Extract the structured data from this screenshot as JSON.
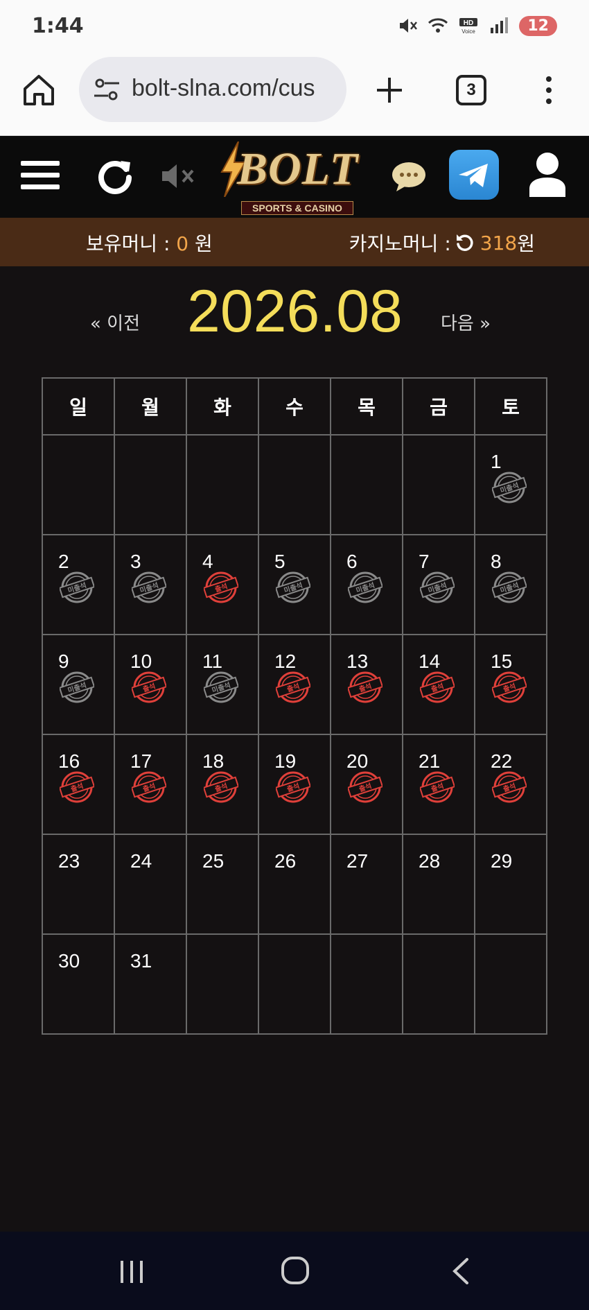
{
  "status_bar": {
    "time": "1:44",
    "battery": "12",
    "icons": [
      "mute-icon",
      "wifi-icon",
      "hd-voice-icon",
      "signal-icon"
    ]
  },
  "browser": {
    "url": "bolt-slna.com/cus",
    "tab_count": "3"
  },
  "site": {
    "logo_text": "BOLT",
    "logo_sub": "SPORTS & CASINO"
  },
  "balance": {
    "held_label": "보유머니 : ",
    "held_amount": "0",
    "held_unit": " 원",
    "casino_label": "카지노머니 : ",
    "casino_amount": "318",
    "casino_unit": " 원"
  },
  "month_nav": {
    "prev_label": "« 이전",
    "title": "2026.08",
    "next_label": "다음 »"
  },
  "calendar": {
    "weekdays": [
      "일",
      "월",
      "화",
      "수",
      "목",
      "금",
      "토"
    ],
    "stamp_labels": {
      "absent": "미출석",
      "present": "출석"
    },
    "weeks": [
      [
        {
          "day": ""
        },
        {
          "day": ""
        },
        {
          "day": ""
        },
        {
          "day": ""
        },
        {
          "day": ""
        },
        {
          "day": ""
        },
        {
          "day": "1",
          "stamp": "absent"
        }
      ],
      [
        {
          "day": "2",
          "stamp": "absent"
        },
        {
          "day": "3",
          "stamp": "absent"
        },
        {
          "day": "4",
          "stamp": "present"
        },
        {
          "day": "5",
          "stamp": "absent"
        },
        {
          "day": "6",
          "stamp": "absent"
        },
        {
          "day": "7",
          "stamp": "absent"
        },
        {
          "day": "8",
          "stamp": "absent"
        }
      ],
      [
        {
          "day": "9",
          "stamp": "absent"
        },
        {
          "day": "10",
          "stamp": "present"
        },
        {
          "day": "11",
          "stamp": "absent"
        },
        {
          "day": "12",
          "stamp": "present"
        },
        {
          "day": "13",
          "stamp": "present"
        },
        {
          "day": "14",
          "stamp": "present"
        },
        {
          "day": "15",
          "stamp": "present"
        }
      ],
      [
        {
          "day": "16",
          "stamp": "present"
        },
        {
          "day": "17",
          "stamp": "present"
        },
        {
          "day": "18",
          "stamp": "present"
        },
        {
          "day": "19",
          "stamp": "present"
        },
        {
          "day": "20",
          "stamp": "present"
        },
        {
          "day": "21",
          "stamp": "present"
        },
        {
          "day": "22",
          "stamp": "present"
        }
      ],
      [
        {
          "day": "23"
        },
        {
          "day": "24"
        },
        {
          "day": "25"
        },
        {
          "day": "26"
        },
        {
          "day": "27"
        },
        {
          "day": "28"
        },
        {
          "day": "29"
        }
      ],
      [
        {
          "day": "30"
        },
        {
          "day": "31"
        },
        {
          "day": ""
        },
        {
          "day": ""
        },
        {
          "day": ""
        },
        {
          "day": ""
        },
        {
          "day": ""
        }
      ]
    ]
  },
  "colors": {
    "accent_gold": "#f4dd5a",
    "balance_amount": "#f2a54a",
    "stamp_present": "#e0403a",
    "stamp_absent": "#8a8a8a"
  }
}
